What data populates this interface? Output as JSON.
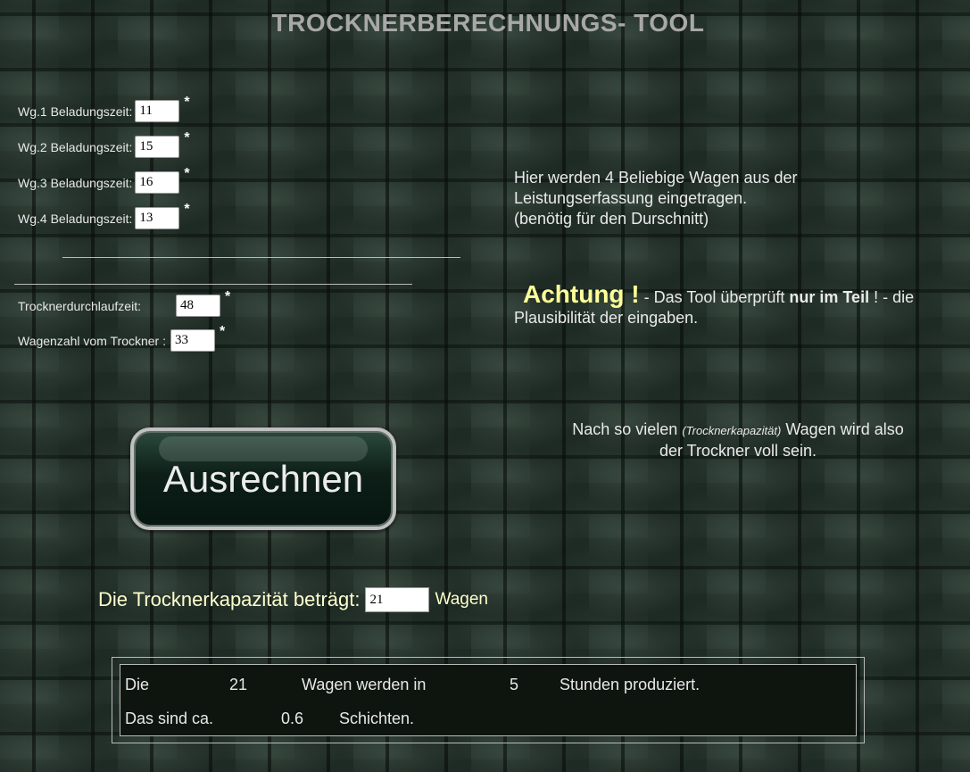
{
  "title": "TROCKNERBERECHNUNGS- TOOL",
  "wagons": [
    {
      "label": "Wg.1 Beladungszeit:",
      "value": "11"
    },
    {
      "label": "Wg.2 Beladungszeit:",
      "value": "15"
    },
    {
      "label": "Wg.3 Beladungszeit:",
      "value": "16"
    },
    {
      "label": "Wg.4 Beladungszeit:",
      "value": "13"
    }
  ],
  "required_mark": "*",
  "dryer": {
    "runtime_label": "Trocknerdurchlaufzeit:",
    "runtime_value": "48",
    "count_label": "Wagenzahl vom Trockner :",
    "count_value": "33"
  },
  "info": {
    "line1": "Hier werden 4 Beliebige Wagen aus der",
    "line2": "Leistungserfassung eingetragen.",
    "line3": "(benötig für den Durschnitt)"
  },
  "warning": {
    "word": "Achtung !",
    "text_a": " - Das Tool überprüft ",
    "strong": "nur im Teil",
    "text_b": " ! - die",
    "line2": "Plausibilität der eingaben."
  },
  "capacity_hint": {
    "before": "Nach so vielen ",
    "em": "(Trocknerkapazität)",
    "after": " Wagen wird also",
    "line2": "der Trockner voll sein."
  },
  "button_label": "Ausrechnen",
  "result": {
    "label": "Die Trocknerkapazität beträgt:",
    "value": "21",
    "unit": "Wagen"
  },
  "summary": {
    "w1": "Die",
    "wagons": "21",
    "w2": "Wagen werden in",
    "hours": "5",
    "w3": "Stunden produziert.",
    "w4": "Das sind ca.",
    "shifts": "0.6",
    "w5": "Schichten."
  }
}
